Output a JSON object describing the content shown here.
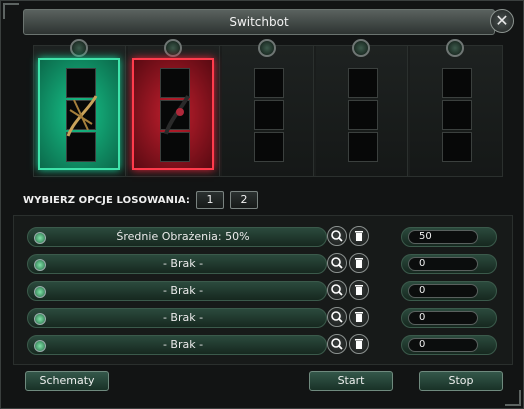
{
  "window": {
    "title": "Switchbot",
    "close_label": "✕"
  },
  "slots": [
    {
      "state": "green",
      "has_item": true
    },
    {
      "state": "red",
      "has_item": true
    },
    {
      "state": "empty",
      "has_item": false
    },
    {
      "state": "empty",
      "has_item": false
    },
    {
      "state": "empty",
      "has_item": false
    }
  ],
  "options": {
    "label": "WYBIERZ OPCJE LOSOWANIA:",
    "buttons": [
      "1",
      "2"
    ]
  },
  "bonuses": [
    {
      "label": "Średnie Obrażenia: 50%",
      "value": "50"
    },
    {
      "label": "- Brak -",
      "value": "0"
    },
    {
      "label": "- Brak -",
      "value": "0"
    },
    {
      "label": "- Brak -",
      "value": "0"
    },
    {
      "label": "- Brak -",
      "value": "0"
    }
  ],
  "footer": {
    "schemes_label": "Schematy",
    "start_label": "Start",
    "stop_label": "Stop"
  },
  "colors": {
    "green_glow": "#1ad19a",
    "red_glow": "#e0243a",
    "accent": "#34574a"
  }
}
